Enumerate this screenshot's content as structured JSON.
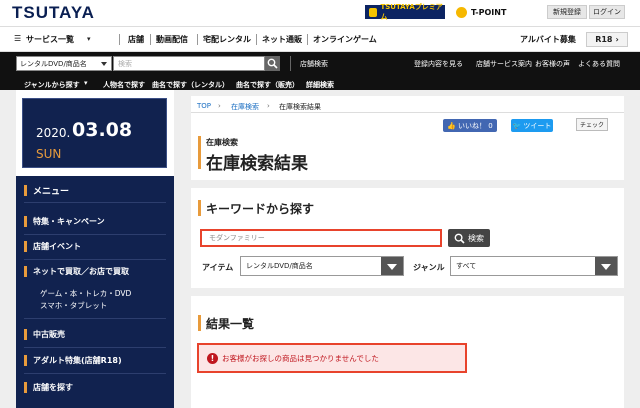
{
  "header": {
    "logo": "TSUTAYA",
    "premium": "TSUTAYAプレミアム",
    "tpoint": "T-POINT",
    "signup": "新規登録",
    "login": "ログイン"
  },
  "nav": {
    "service": "サービス一覧",
    "items": [
      "店舗",
      "動画配信",
      "宅配レンタル",
      "ネット通販",
      "オンラインゲーム"
    ],
    "job": "アルバイト募集",
    "r18": "R18"
  },
  "searchbar": {
    "category": "レンタルDVD/商品名",
    "placeholder": "検索",
    "store_search": "店舗検索",
    "links_top": [
      "登録内容を見る",
      "店舗サービス案内",
      "お客様の声",
      "よくある質問"
    ],
    "links_bottom": [
      "ジャンルから探す",
      "人物名で探す",
      "曲名で探す（レンタル）",
      "曲名で探す（販売）",
      "詳細検索"
    ]
  },
  "sidebar": {
    "date_year": "2020.",
    "date_md": "03.08",
    "date_day": "SUN",
    "menu_title": "メニュー",
    "items": [
      "特集・キャンペーン",
      "店舗イベント",
      "ネットで買取／お店で買取",
      "中古販売",
      "アダルト特集(店舗R18)",
      "店舗を探す"
    ],
    "subitems": [
      "ゲーム・本・トレカ・DVD",
      "スマホ・タブレット"
    ]
  },
  "breadcrumb": [
    "TOP",
    "在庫検索",
    "在庫検索結果"
  ],
  "social": {
    "like": "いいね！ 0",
    "tweet": "ツイート",
    "check": "チェック"
  },
  "page": {
    "subtitle": "在庫検索",
    "title": "在庫検索結果"
  },
  "keyword": {
    "heading": "キーワードから探す",
    "value": "モダンファミリー",
    "button": "検索",
    "item_label": "アイテム",
    "item_value": "レンタルDVD/商品名",
    "genre_label": "ジャンル",
    "genre_value": "すべて"
  },
  "results": {
    "heading": "結果一覧",
    "error": "お客様がお探しの商品は見つかりませんでした"
  },
  "colors": {
    "navy": "#11224f",
    "accent": "#e89b3c",
    "error": "#e8432c"
  }
}
